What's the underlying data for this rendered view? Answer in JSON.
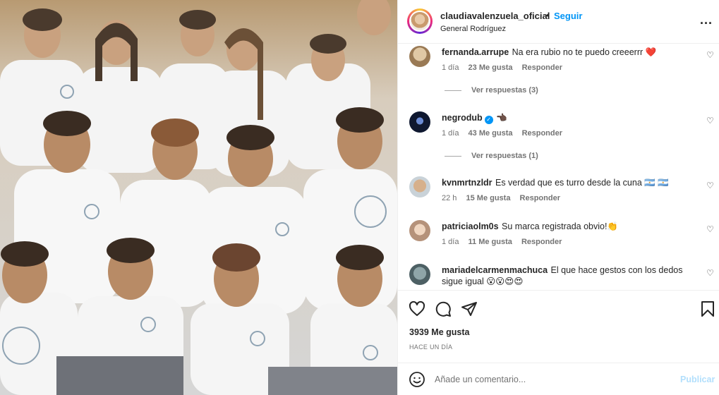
{
  "header": {
    "username": "claudiavalenzuela_oficial",
    "separator": "•",
    "follow_label": "Seguir",
    "location": "General Rodríguez",
    "more_label": "..."
  },
  "comments": [
    {
      "user": "fernanda.arrupe",
      "text": "Na era rubio no te puedo creeerrr ❤️",
      "age": "1 día",
      "likes": "23 Me gusta",
      "reply": "Responder",
      "replies": "Ver respuestas (3)",
      "avatar": "#b79a74"
    },
    {
      "user": "negrodub",
      "text": "👈🏿",
      "age": "1 día",
      "likes": "43 Me gusta",
      "reply": "Responder",
      "replies": "Ver respuestas (1)",
      "avatar": "#1d2b4a",
      "verified": true
    },
    {
      "user": "kvnmrtnzldr",
      "text": "Es verdad que es turro desde la cuna 🇦🇷 🇦🇷",
      "age": "22 h",
      "likes": "15 Me gusta",
      "reply": "Responder",
      "avatar": "#a8b3ba"
    },
    {
      "user": "patriciaolm0s",
      "text": "Su marca registrada obvio!👏",
      "age": "1 día",
      "likes": "11 Me gusta",
      "reply": "Responder",
      "avatar": "#d9b79d"
    },
    {
      "user": "mariadelcarmenmachuca",
      "text": "El que hace gestos con los dedos",
      "text2": "sigue igual 😮😮😍😍",
      "avatar": "#6f8a8f"
    }
  ],
  "actions": {
    "likes": "3939 Me gusta",
    "time": "HACE UN DÍA"
  },
  "add_comment": {
    "placeholder": "Añade un comentario...",
    "publish_label": "Publicar"
  },
  "icons": {
    "like": "heart-icon",
    "comment": "comment-icon",
    "share": "paper-plane-icon",
    "save": "bookmark-icon",
    "emoji": "smiley-icon",
    "more": "ellipsis-icon"
  }
}
